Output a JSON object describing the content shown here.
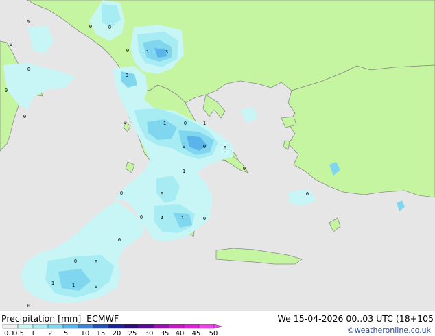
{
  "map": {
    "background": "#e6e6e6",
    "land_color": "#c5f5a0",
    "coast_color": "#8a8a8a",
    "precip_colors": [
      "#c8f5f5",
      "#a6ecf2",
      "#7fd6ee",
      "#5ab4ea"
    ],
    "value_labels": [
      "0",
      "0",
      "0",
      "0",
      "0",
      "0",
      "1",
      "3",
      "3",
      "0",
      "0",
      "1",
      "0",
      "0",
      "1",
      "0",
      "0",
      "0",
      "1",
      "0",
      "0",
      "0",
      "0",
      "1",
      "4",
      "0",
      "0",
      "0",
      "0",
      "1",
      "1",
      "0",
      "0",
      "0"
    ]
  },
  "footer": {
    "product": "Precipitation [mm]",
    "model": "ECMWF",
    "datetime": "We 15-04-2026 00..03 UTC (18+105",
    "credit": "©weatheronline.co.uk"
  },
  "legend": {
    "labels": [
      "0.1",
      "0.5",
      "1",
      "2",
      "5",
      "10",
      "15",
      "20",
      "25",
      "30",
      "35",
      "40",
      "45",
      "50"
    ],
    "colors": [
      "#f0f0f0",
      "#c8f5f5",
      "#a6ecf2",
      "#7fd6ee",
      "#5ab4ea",
      "#3c84d8",
      "#2050b8",
      "#18209a",
      "#2c0c7a",
      "#5a0898",
      "#9810b4",
      "#c818c4",
      "#e020d8",
      "#f040e8"
    ],
    "arrow_color": "#ee44ee"
  }
}
